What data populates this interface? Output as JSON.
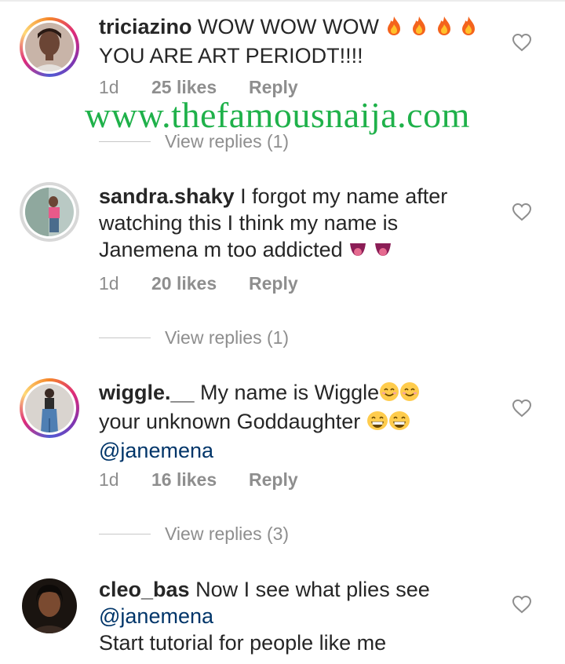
{
  "watermark": "www.thefamousnaija.com",
  "icons": {
    "like": "heart-outline-icon",
    "fire": "fire-emoji",
    "tongue": "tongue-emoji",
    "smile": "smiling-emoji",
    "grin": "grinning-emoji"
  },
  "comments": [
    {
      "username": "triciazino",
      "text": " WOW WOW WOW",
      "line2": "YOU ARE ART PERIODT!!!!",
      "time": "1d",
      "likes": "25 likes",
      "reply": "Reply",
      "view_replies": "View replies (1)"
    },
    {
      "username": "sandra.shaky",
      "text": " I forgot my name after",
      "line2": "watching this I think my name is",
      "line3": "Janemena m too addicted",
      "time": "1d",
      "likes": "20 likes",
      "reply": "Reply",
      "view_replies": "View replies (1)"
    },
    {
      "username": "wiggle.__",
      "text": " My name is Wiggle",
      "line2": "your unknown Goddaughter",
      "mention": "@janemena",
      "time": "1d",
      "likes": "16 likes",
      "reply": "Reply",
      "view_replies": "View replies (3)"
    },
    {
      "username": "cleo_bas",
      "text": " Now I see what plies see",
      "mention": "@janemena",
      "line3": "Start tutorial for people like me"
    }
  ]
}
